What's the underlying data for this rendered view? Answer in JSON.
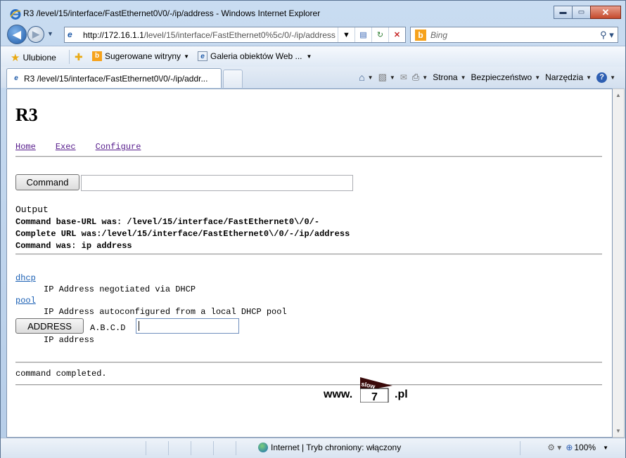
{
  "window": {
    "title": "R3 /level/15/interface/FastEthernet0\\/0/-/ip/address - Windows Internet Explorer",
    "minimize": "▬",
    "maximize": "▭",
    "close": "✕"
  },
  "nav": {
    "url_domain": "http://172.16.1.1",
    "url_path": "/level/15/interface/FastEthernet0%5c/0/-/ip/address",
    "search_placeholder": "Bing"
  },
  "favorites": {
    "favorites_label": "Ulubione",
    "suggested_label": "Sugerowane witryny",
    "gallery_label": "Galeria obiektów Web ..."
  },
  "tab": {
    "label": "R3 /level/15/interface/FastEthernet0\\/0/-/ip/addr..."
  },
  "commandbar": {
    "page_menu": "Strona",
    "safety_menu": "Bezpieczeństwo",
    "tools_menu": "Narzędzia"
  },
  "page": {
    "heading": "R3",
    "links": [
      "Home",
      "Exec",
      "Configure"
    ],
    "command_button": "Command",
    "command_value": "",
    "output_heading": "Output",
    "output_lines": [
      "Command base-URL was: /level/15/interface/FastEthernet0\\/0/-",
      "Complete URL was:/level/15/interface/FastEthernet0\\/0/-/ip/address",
      "Command was: ip address"
    ],
    "options": [
      {
        "keyword": "dhcp",
        "desc": "IP Address negotiated via DHCP"
      },
      {
        "keyword": "pool",
        "desc": "IP Address autoconfigured from a local DHCP pool"
      }
    ],
    "address_button": "ADDRESS",
    "address_hint": "A.B.C.D",
    "address_value": "",
    "address_desc": "IP address",
    "completed": "command completed.",
    "logo": {
      "www": "www.",
      "slow": "slow",
      "seven": "7",
      "pl": ".pl"
    }
  },
  "status": {
    "zone_text": "Internet | Tryb chroniony: włączony",
    "zoom": "100%"
  }
}
